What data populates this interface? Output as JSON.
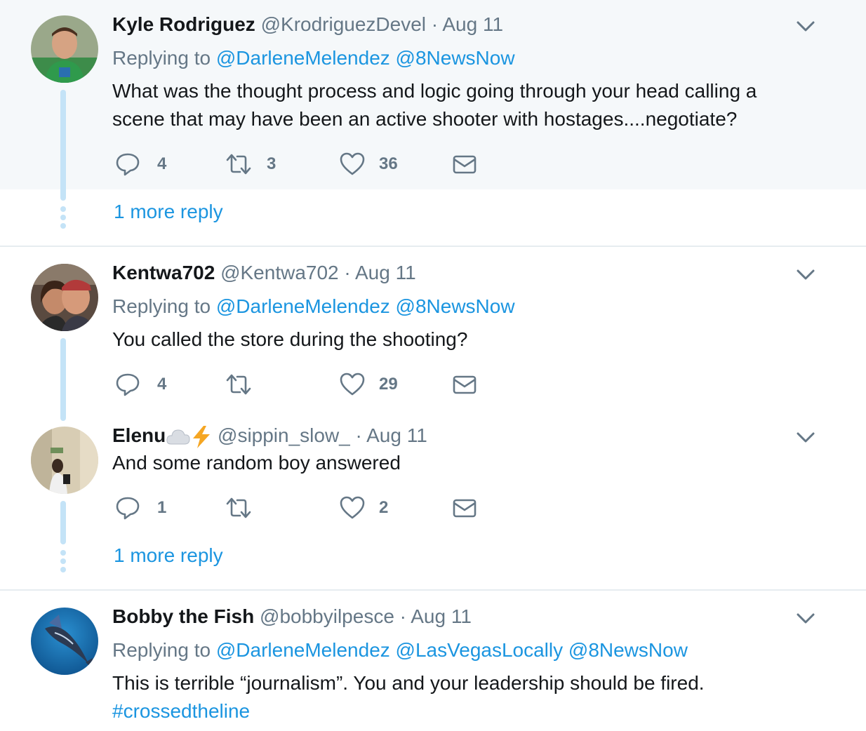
{
  "replying_to_label": "Replying to",
  "more_reply_label": "1 more reply",
  "tweets": [
    {
      "name": "Kyle Rodriguez",
      "handle": "@KrodriguezDevel",
      "date": "Aug 11",
      "mentions": [
        "@DarleneMelendez",
        "@8NewsNow"
      ],
      "text": "What was the thought process and logic going through your head calling a scene that may have been an active shooter with hostages....negotiate?",
      "replies": "4",
      "retweets": "3",
      "likes": "36"
    },
    {
      "name": "Kentwa702",
      "handle": "@Kentwa702",
      "date": "Aug 11",
      "mentions": [
        "@DarleneMelendez",
        "@8NewsNow"
      ],
      "text": "You called the store during the shooting?",
      "replies": "4",
      "retweets": "",
      "likes": "29"
    },
    {
      "name": "Elenu",
      "name_emoji": [
        "cloud-icon",
        "lightning-icon"
      ],
      "handle": "@sippin_slow_",
      "date": "Aug 11",
      "text": "And some random boy answered",
      "replies": "1",
      "retweets": "",
      "likes": "2"
    },
    {
      "name": "Bobby the Fish",
      "handle": "@bobbyilpesce",
      "date": "Aug 11",
      "mentions": [
        "@DarleneMelendez",
        "@LasVegasLocally",
        "@8NewsNow"
      ],
      "text": "This is terrible “journalism”. You and your leadership should be fired.",
      "hashtag": "#crossedtheline"
    }
  ],
  "separator": "·",
  "icons": {
    "reply": "reply-icon",
    "retweet": "retweet-icon",
    "like": "heart-icon",
    "dm": "envelope-icon",
    "menu": "chevron-down-icon"
  },
  "colors": {
    "link": "#1b95e0",
    "muted": "#657786",
    "thread": "#c4e3f7",
    "highlight_bg": "#f5f8fa"
  }
}
